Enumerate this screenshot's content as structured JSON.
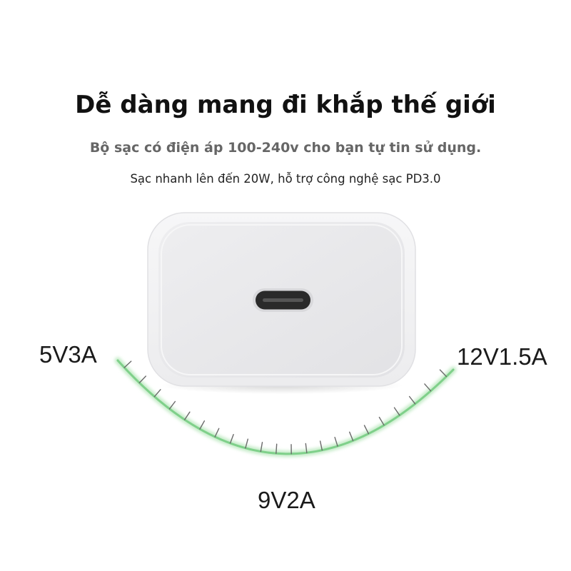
{
  "heading": {
    "title": "Dễ dàng mang đi khắp thế giới",
    "subtitle": "Bộ sạc có điện áp 100-240v cho bạn tự tin sử dụng.",
    "note": "Sạc nhanh lên đến 20W, hỗ trợ công nghệ sạc PD3.0"
  },
  "power_modes": {
    "left": "5V3A",
    "bottom": "9V2A",
    "right": "12V1.5A"
  },
  "colors": {
    "arc": "#7fd08a",
    "arc_glow": "#c6ecc9",
    "ticks": "#6a6a6a",
    "charger_body": "#f2f2f3",
    "charger_face": "#e9e9eb",
    "port": "#2a2a2a"
  },
  "icons": {
    "charger": "usb-c-power-adapter",
    "port": "usb-c-port"
  }
}
